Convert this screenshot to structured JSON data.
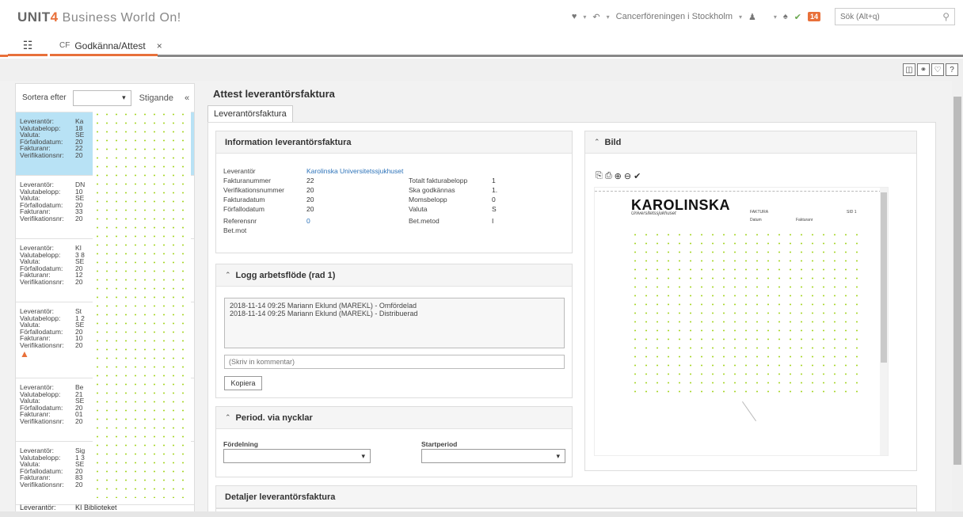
{
  "header": {
    "logo_unit": "UNIT",
    "logo_four": "4",
    "logo_rest": "Business World On!",
    "heart": "♥",
    "history": "↶",
    "company": "Cancerföreningen i Stockholm",
    "user": "♟",
    "bell": "♠",
    "check": "✔",
    "badge": "14",
    "search_placeholder": "Sök (Alt+q)"
  },
  "tabs": {
    "menu": "☷",
    "active_prefix": "CF",
    "active_label": "Godkänna/Attest",
    "close": "×"
  },
  "toolbar": {
    "icons": [
      "◫",
      "⚭",
      "♡",
      "?"
    ]
  },
  "list": {
    "sort_label": "Sortera efter",
    "sort_caret": "▾",
    "sort_direction": "Stigande",
    "collapse": "«",
    "items": [
      {
        "rows": [
          [
            "Leverantör:",
            "Ka"
          ],
          [
            "Valutabelopp:",
            "18"
          ],
          [
            "Valuta:",
            "SE"
          ],
          [
            "Förfallodatum:",
            "20"
          ],
          [
            "Fakturanr:",
            "22"
          ],
          [
            "Verifikationsnr:",
            "20"
          ]
        ],
        "selected": true
      },
      {
        "rows": [
          [
            "Leverantör:",
            "DN"
          ],
          [
            "Valutabelopp:",
            "10"
          ],
          [
            "Valuta:",
            "SE"
          ],
          [
            "Förfallodatum:",
            "20"
          ],
          [
            "Fakturanr:",
            "33"
          ],
          [
            "Verifikationsnr:",
            "20"
          ]
        ],
        "selected": false
      },
      {
        "rows": [
          [
            "Leverantör:",
            "KI"
          ],
          [
            "Valutabelopp:",
            "3 8"
          ],
          [
            "Valuta:",
            "SE"
          ],
          [
            "Förfallodatum:",
            "20"
          ],
          [
            "Fakturanr:",
            "12"
          ],
          [
            "Verifikationsnr:",
            "20"
          ]
        ],
        "selected": false
      },
      {
        "rows": [
          [
            "Leverantör:",
            "St"
          ],
          [
            "Valutabelopp:",
            "1 2"
          ],
          [
            "Valuta:",
            "SE"
          ],
          [
            "Förfallodatum:",
            "20"
          ],
          [
            "Fakturanr:",
            "10"
          ],
          [
            "Verifikationsnr:",
            "20"
          ]
        ],
        "selected": false,
        "warning": "▲"
      },
      {
        "rows": [
          [
            "Leverantör:",
            "Be"
          ],
          [
            "Valutabelopp:",
            "21"
          ],
          [
            "Valuta:",
            "SE"
          ],
          [
            "Förfallodatum:",
            "20"
          ],
          [
            "Fakturanr:",
            "01"
          ],
          [
            "Verifikationsnr:",
            "20"
          ]
        ],
        "selected": false
      },
      {
        "rows": [
          [
            "Leverantör:",
            "Sig"
          ],
          [
            "Valutabelopp:",
            "1 3"
          ],
          [
            "Valuta:",
            "SE"
          ],
          [
            "Förfallodatum:",
            "20"
          ],
          [
            "Fakturanr:",
            "83"
          ],
          [
            "Verifikationsnr:",
            "20"
          ]
        ],
        "selected": false
      }
    ],
    "last_label": "Leverantör:",
    "last_value": "KI Biblioteket"
  },
  "main": {
    "title": "Attest leverantörsfaktura",
    "subtab": "Leverantörsfaktura",
    "info": {
      "title": "Information leverantörsfaktura",
      "leverantor_key": "Leverantör",
      "leverantor_val": "Karolinska Universitetssjukhuset",
      "fakturanummer_key": "Fakturanummer",
      "fakturanummer_val": "22",
      "verifikationsnummer_key": "Verifikationsnummer",
      "verifikationsnummer_val": "20",
      "fakturadatum_key": "Fakturadatum",
      "fakturadatum_val": "20",
      "forfallodatum_key": "Förfallodatum",
      "forfallodatum_val": "20",
      "referensnr_key": "Referensnr",
      "referensnr_val": "0",
      "betmot_key": "Bet.mot",
      "totalt_key": "Totalt fakturabelopp",
      "totalt_val": "1",
      "ska_key": "Ska godkännas",
      "ska_val": "1.",
      "moms_key": "Momsbelopp",
      "moms_val": "0",
      "valuta_key": "Valuta",
      "valuta_val": "S",
      "betmetod_key": "Bet.metod",
      "betmetod_val": "I"
    },
    "log": {
      "chevron": "⌃",
      "title": "Logg arbetsflöde (rad 1)",
      "entries": [
        "2018-11-14 09:25 Mariann Eklund (MAREKL) - Omfördelad",
        "2018-11-14 09:25 Mariann Eklund (MAREKL) - Distribuerad"
      ],
      "comment_placeholder": "(Skriv in kommentar)",
      "copy_button": "Kopiera"
    },
    "period": {
      "chevron": "⌃",
      "title": "Period. via nycklar",
      "fordelning_label": "Fördelning",
      "startperiod_label": "Startperiod",
      "caret": "▾"
    },
    "image": {
      "chevron": "⌃",
      "title": "Bild",
      "tools": [
        "⎘",
        "⎙",
        "⊕",
        "⊖",
        "✔"
      ],
      "brand": "KAROLINSKA",
      "brand_sub": "Universitetssjukhuset",
      "doc_faktura": "FAKTURA",
      "doc_datum": "Datum",
      "doc_fakturanr": "Fakturanr",
      "doc_sid": "SID 1"
    },
    "details": {
      "title": "Detaljer leverantörsfaktura"
    }
  }
}
